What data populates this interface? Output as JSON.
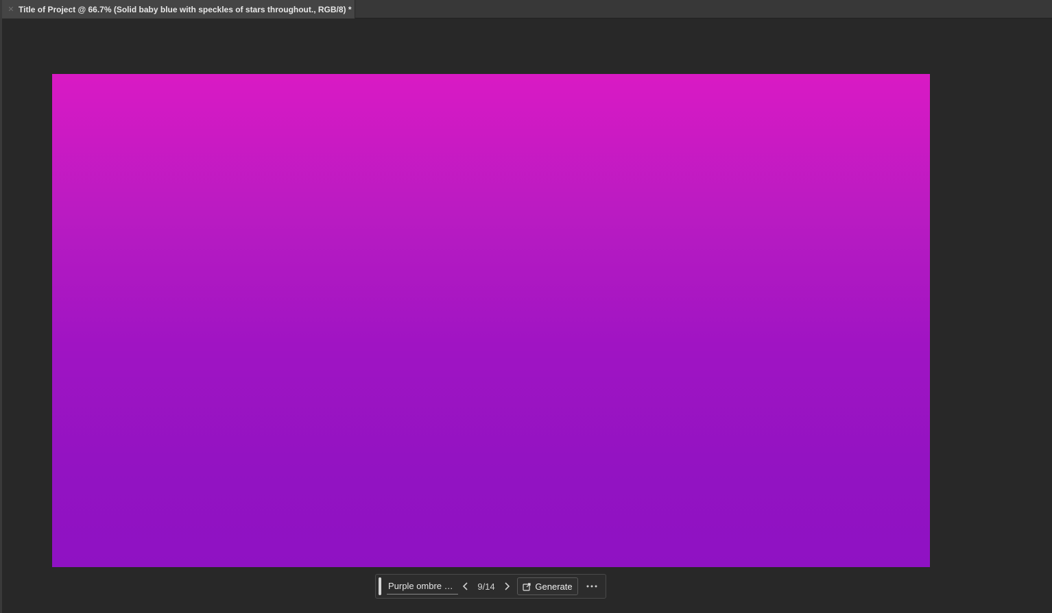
{
  "document_tab": {
    "title": "Title of Project @ 66.7% (Solid baby blue with speckles of stars throughout., RGB/8) *",
    "close_icon": "close-icon"
  },
  "canvas": {
    "gradient_top_color": "#d91ac4",
    "gradient_bottom_color": "#8f12c3"
  },
  "generate_bar": {
    "prompt_value": "Purple ombre w...",
    "counter": "9/14",
    "generate_label": "Generate",
    "icons": {
      "previous": "chevron-left-icon",
      "next": "chevron-right-icon",
      "generate": "generate-icon",
      "more": "more-options-icon"
    }
  }
}
